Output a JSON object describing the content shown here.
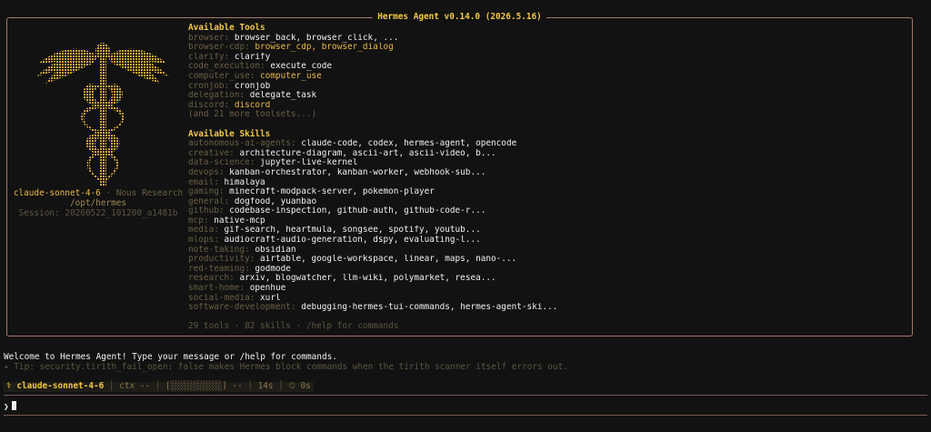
{
  "panel": {
    "title": "Hermes Agent v0.14.0 (2026.5.16)"
  },
  "identity": {
    "model": "claude-sonnet-4-6",
    "separator": " · ",
    "provider": "Nous Research",
    "path": "/opt/hermes",
    "session": "Session: 20260522_101200_a1481b"
  },
  "tools": {
    "heading": "Available Tools",
    "rows": [
      {
        "key": "browser:",
        "value": "browser_back, browser_click, ...",
        "style": "white"
      },
      {
        "key": "browser-cdp:",
        "value": "browser_cdp, browser_dialog",
        "style": "gold"
      },
      {
        "key": "clarify:",
        "value": "clarify",
        "style": "white"
      },
      {
        "key": "code_execution:",
        "value": "execute_code",
        "style": "white"
      },
      {
        "key": "computer_use:",
        "value": "computer_use",
        "style": "gold"
      },
      {
        "key": "cronjob:",
        "value": "cronjob",
        "style": "white"
      },
      {
        "key": "delegation:",
        "value": "delegate_task",
        "style": "white"
      },
      {
        "key": "discord:",
        "value": "discord",
        "style": "gold"
      }
    ],
    "more": "(and 21 more toolsets...)"
  },
  "skills": {
    "heading": "Available Skills",
    "rows": [
      {
        "key": "autonomous-ai-agents:",
        "value": "claude-code, codex, hermes-agent, opencode"
      },
      {
        "key": "creative:",
        "value": "architecture-diagram, ascii-art, ascii-video, b..."
      },
      {
        "key": "data-science:",
        "value": "jupyter-live-kernel"
      },
      {
        "key": "devops:",
        "value": "kanban-orchestrator, kanban-worker, webhook-sub..."
      },
      {
        "key": "email:",
        "value": "himalaya"
      },
      {
        "key": "gaming:",
        "value": "minecraft-modpack-server, pokemon-player"
      },
      {
        "key": "general:",
        "value": "dogfood, yuanbao"
      },
      {
        "key": "github:",
        "value": "codebase-inspection, github-auth, github-code-r..."
      },
      {
        "key": "mcp:",
        "value": "native-mcp"
      },
      {
        "key": "media:",
        "value": "gif-search, heartmula, songsee, spotify, youtub..."
      },
      {
        "key": "mlops:",
        "value": "audiocraft-audio-generation, dspy, evaluating-l..."
      },
      {
        "key": "note-taking:",
        "value": "obsidian"
      },
      {
        "key": "productivity:",
        "value": "airtable, google-workspace, linear, maps, nano-..."
      },
      {
        "key": "red-teaming:",
        "value": "godmode"
      },
      {
        "key": "research:",
        "value": "arxiv, blogwatcher, llm-wiki, polymarket, resea..."
      },
      {
        "key": "smart-home:",
        "value": "openhue"
      },
      {
        "key": "social-media:",
        "value": "xurl"
      },
      {
        "key": "software-development:",
        "value": "debugging-hermes-tui-commands, hermes-agent-ski..."
      }
    ]
  },
  "footer": "29 tools · 82 skills · /help for commands",
  "welcome": "Welcome to Hermes Agent! Type your message or /help for commands.",
  "tip": "✦ Tip: security.tirith_fail_open: false makes Hermes block commands when the tirith scanner itself errors out.",
  "statusbar": {
    "icon": "⚕",
    "model": "claude-sonnet-4-6",
    "sep": " │ ",
    "ctx": "ctx --",
    "bar": "[░░░░░░░░░░] --",
    "elapsed": "14s",
    "timer": "⏲ 0s"
  },
  "prompt": {
    "glyph": "❯",
    "value": ""
  },
  "icons": {
    "logo": "caduceus-icon"
  },
  "colors": {
    "accent": "#f3c74a",
    "border": "#a8776a",
    "dim": "#6a5f45",
    "background": "#121212"
  }
}
